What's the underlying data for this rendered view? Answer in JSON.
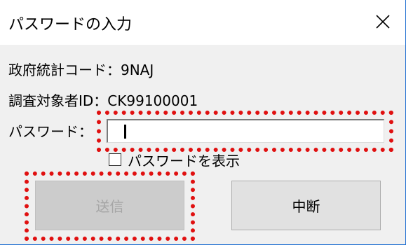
{
  "window": {
    "title": "パスワードの入力",
    "close_symbol": "close-icon"
  },
  "info": {
    "survey_code": "政府統計コード：9NAJ",
    "respondent_id": "調査対象者ID：CK99100001"
  },
  "password": {
    "label": "パスワード：",
    "value": "",
    "show_password_label": "パスワードを表示",
    "show_password_checked": false
  },
  "buttons": {
    "send_label": "送信",
    "send_enabled": false,
    "cancel_label": "中断"
  },
  "colors": {
    "highlight": "#e01010",
    "window_border": "#1f6fd1"
  }
}
